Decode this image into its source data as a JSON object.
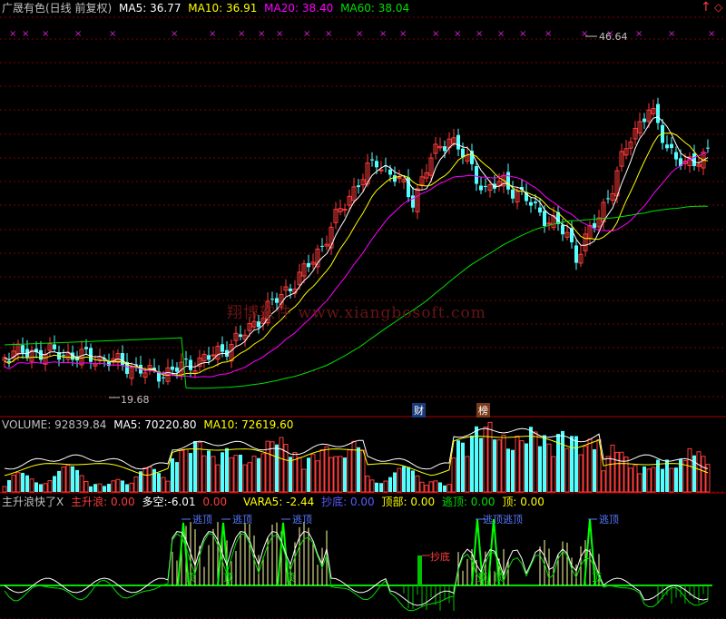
{
  "main_header": {
    "title": "广晟有色(日线 前复权)",
    "ma5_label": "MA5:",
    "ma5_value": "36.77",
    "ma10_label": "MA10:",
    "ma10_value": "36.91",
    "ma20_label": "MA20:",
    "ma20_value": "38.40",
    "ma60_label": "MA60:",
    "ma60_value": "38.04",
    "up_arrow": "↑",
    "diamond": "◇"
  },
  "price_labels": {
    "high": "46.64",
    "low": "19.68"
  },
  "watermark": "翔博软件 www.xiangbosoft.com",
  "event_badges": {
    "cai": "财",
    "bang": "榜"
  },
  "volume_header": {
    "volume_label": "VOLUME:",
    "volume_value": "92839.84",
    "ma5_label": "MA5:",
    "ma5_value": "70220.80",
    "ma10_label": "MA10:",
    "ma10_value": "72619.60"
  },
  "indicator_header": {
    "name": "主升浪快了X",
    "zsl_label": "主升浪:",
    "zsl_value": "0.00",
    "dk_label": "多空:",
    "dk_value": "-6.01",
    "dk_extra": "0.00",
    "vara5_label": "VARA5:",
    "vara5_value": "-2.44",
    "cd_label": "抄底:",
    "cd_value": "0.00",
    "db_label": "顶部:",
    "db_value": "0.00",
    "td_label": "逃顶:",
    "td_value": "0.00",
    "d_label": "顶:",
    "d_value": "0.00"
  },
  "indicator_tags": {
    "escape": "逃顶",
    "bottom_buy": "抄底",
    "top": "顶",
    "escape_pair": "逃顶逃顶"
  },
  "colors": {
    "up": "#ff3c3c",
    "down": "#54ffff",
    "ma5": "#ffffff",
    "ma10": "#ffff00",
    "ma20": "#ff00ff",
    "ma60": "#00e000",
    "grid": "#800000"
  }
}
